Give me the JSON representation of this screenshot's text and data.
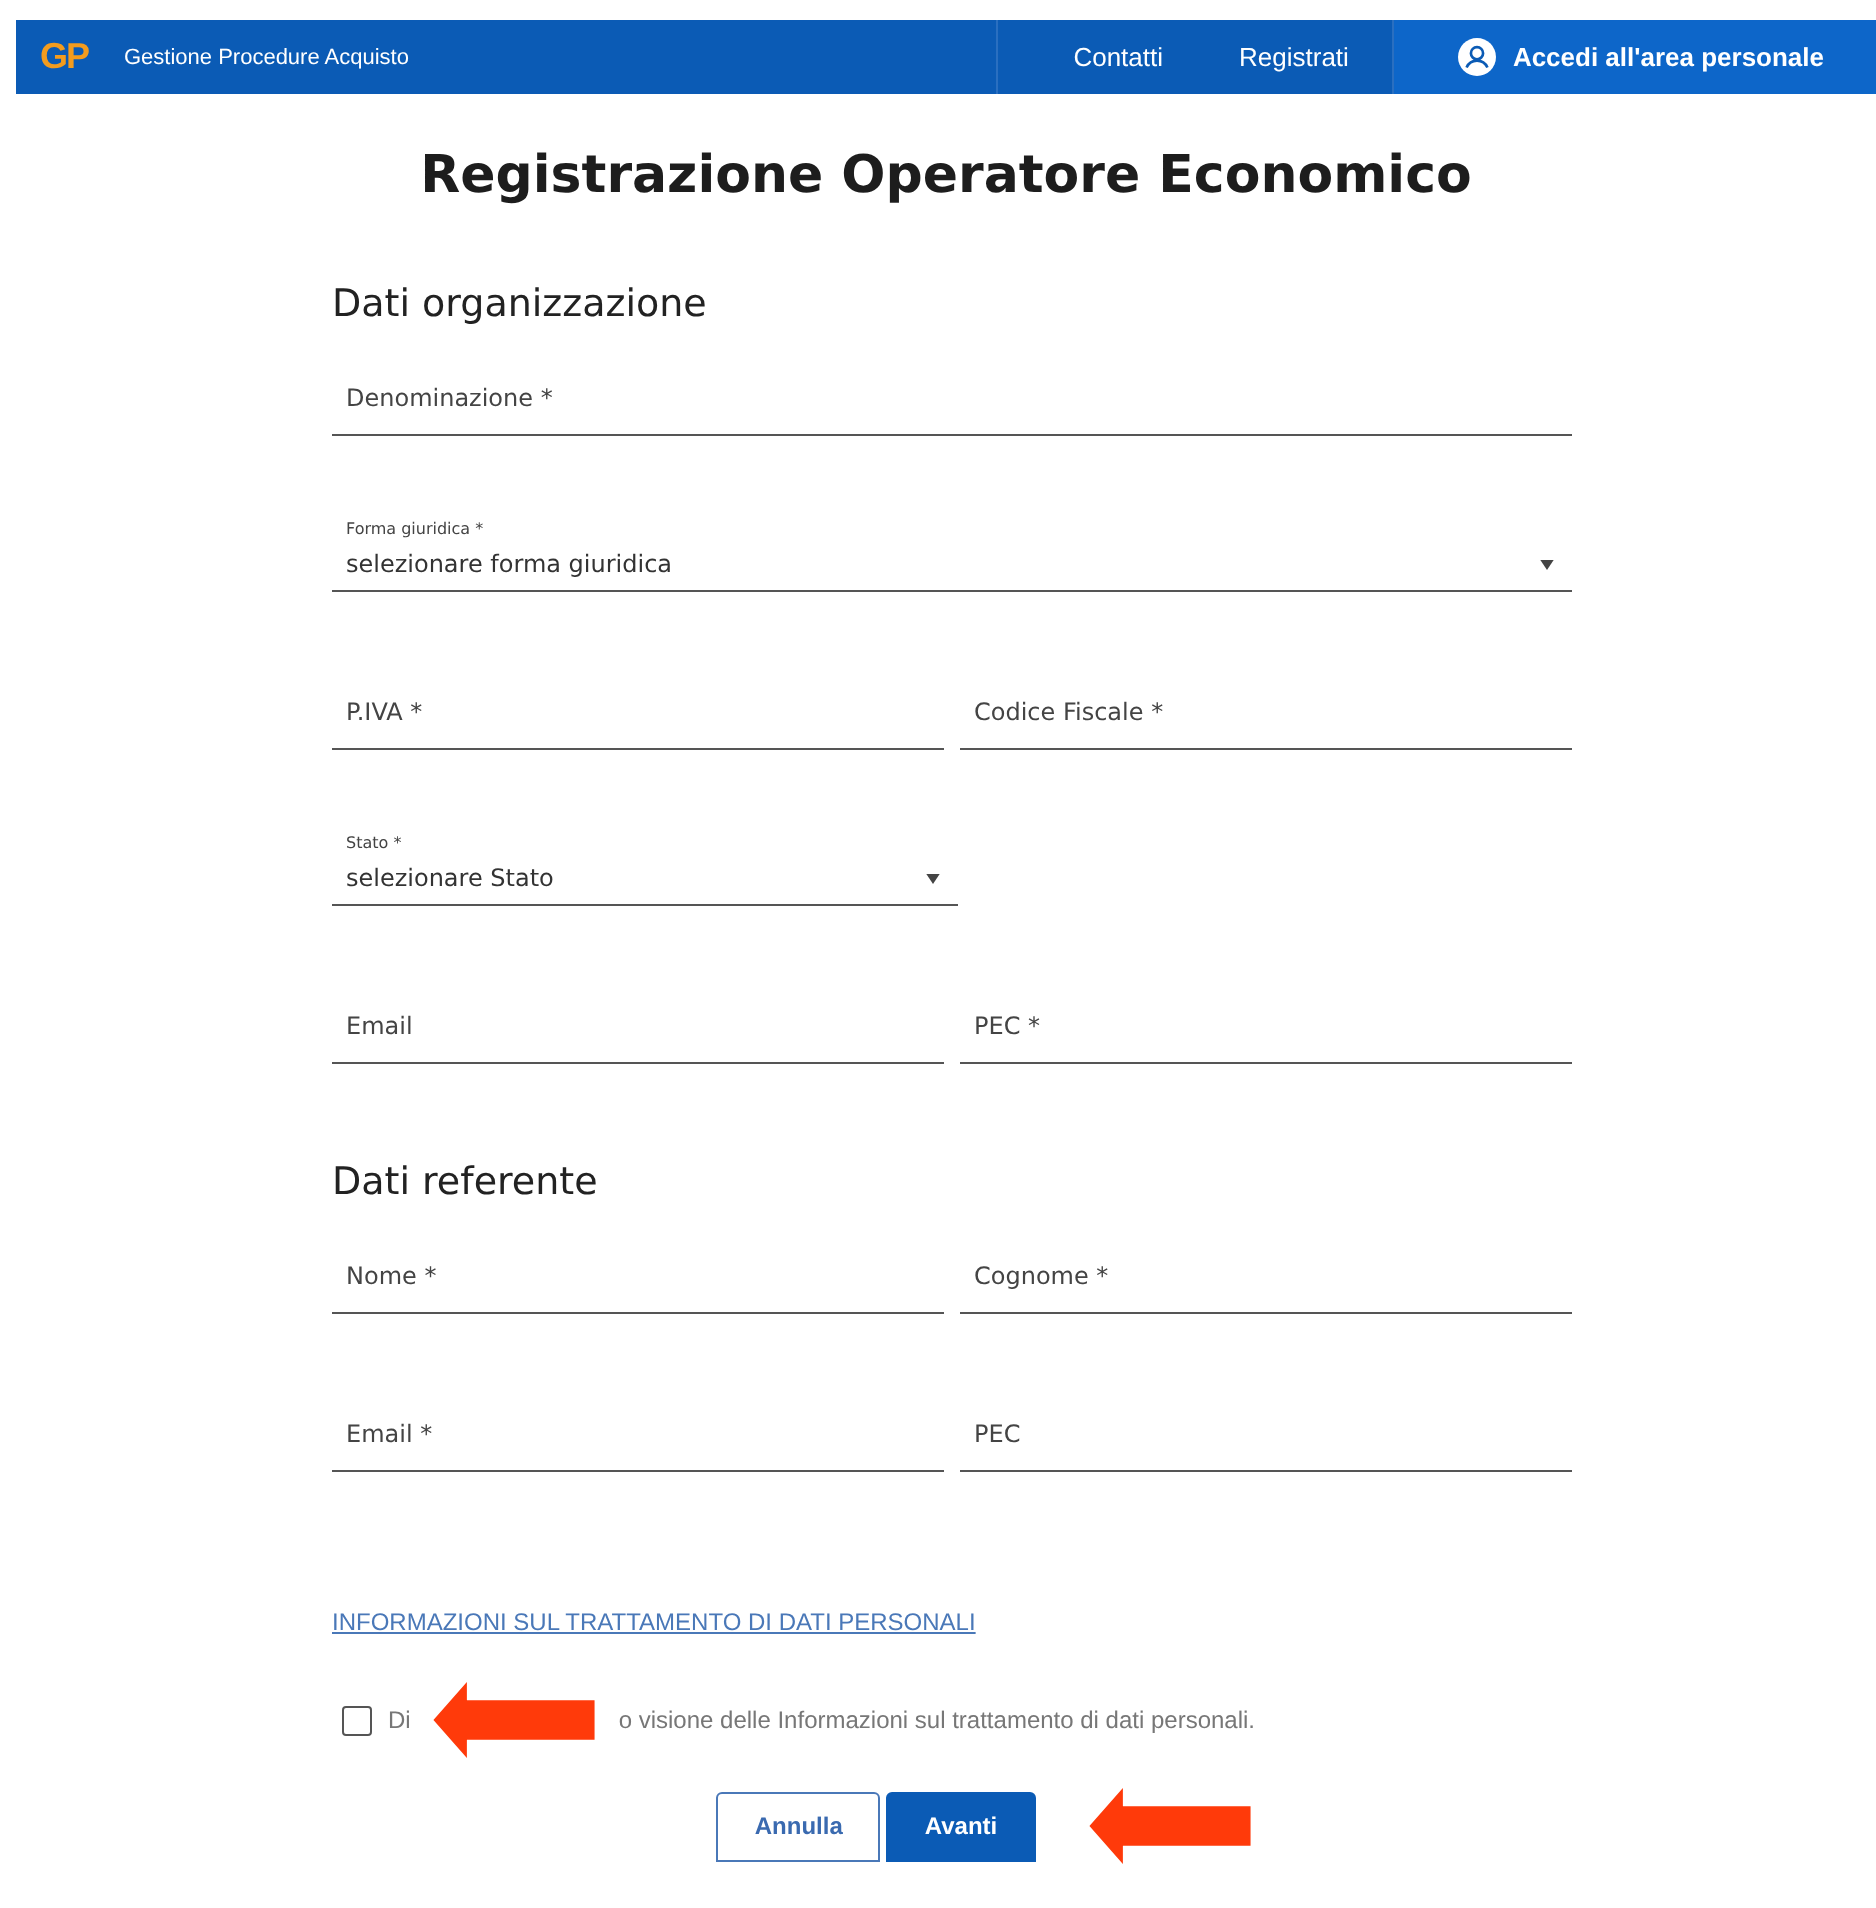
{
  "header": {
    "logo": "GP",
    "app_name": "Gestione Procedure Acquisto",
    "nav": [
      "Contatti",
      "Registrati"
    ],
    "login": "Accedi all'area personale"
  },
  "title": "Registrazione Operatore Economico",
  "sections": [
    {
      "heading": "Dati organizzazione",
      "rows": [
        [
          {
            "kind": "text",
            "placeholder": "Denominazione *"
          }
        ],
        [
          {
            "kind": "select",
            "label": "Forma giuridica *",
            "value": "selezionare forma giuridica"
          }
        ],
        [
          {
            "kind": "text",
            "placeholder": "P.IVA *"
          },
          {
            "kind": "text",
            "placeholder": "Codice Fiscale *"
          }
        ],
        [
          {
            "kind": "select",
            "label": "Stato *",
            "value": "selezionare Stato"
          },
          {
            "kind": "empty"
          }
        ],
        [
          {
            "kind": "text",
            "placeholder": "Email"
          },
          {
            "kind": "text",
            "placeholder": "PEC *"
          }
        ]
      ]
    },
    {
      "heading": "Dati referente",
      "rows": [
        [
          {
            "kind": "text",
            "placeholder": "Nome *"
          },
          {
            "kind": "text",
            "placeholder": "Cognome *"
          }
        ],
        [
          {
            "kind": "text",
            "placeholder": "Email *"
          },
          {
            "kind": "text",
            "placeholder": "PEC"
          }
        ]
      ]
    }
  ],
  "privacy_link": "INFORMAZIONI SUL TRATTAMENTO DI DATI PERSONALI",
  "consent": {
    "checked": false,
    "arrow": true,
    "label_start": "Di",
    "label_end": "o visione delle Informazioni sul trattamento di dati personali."
  },
  "buttons": [
    {
      "kind": "secondary",
      "label": "Annulla"
    },
    {
      "kind": "primary",
      "label": "Avanti"
    }
  ],
  "buttons_arrow": true
}
